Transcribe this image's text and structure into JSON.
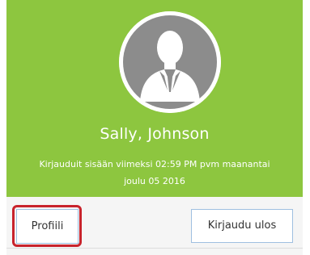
{
  "user_panel": {
    "name": "Sally, Johnson",
    "login_info_line1": "Kirjauduit sisään viimeksi 02:59 PM pvm maanantai",
    "login_info_line2": "joulu 05 2016",
    "avatar_icon": "user-silhouette-icon"
  },
  "actions": {
    "profile_label": "Profiili",
    "logout_label": "Kirjaudu ulos"
  },
  "colors": {
    "header_green": "#8dc63f",
    "highlight_red": "#c8232c",
    "button_border": "#9fbfe0",
    "footer_bg": "#f5f5f5"
  }
}
